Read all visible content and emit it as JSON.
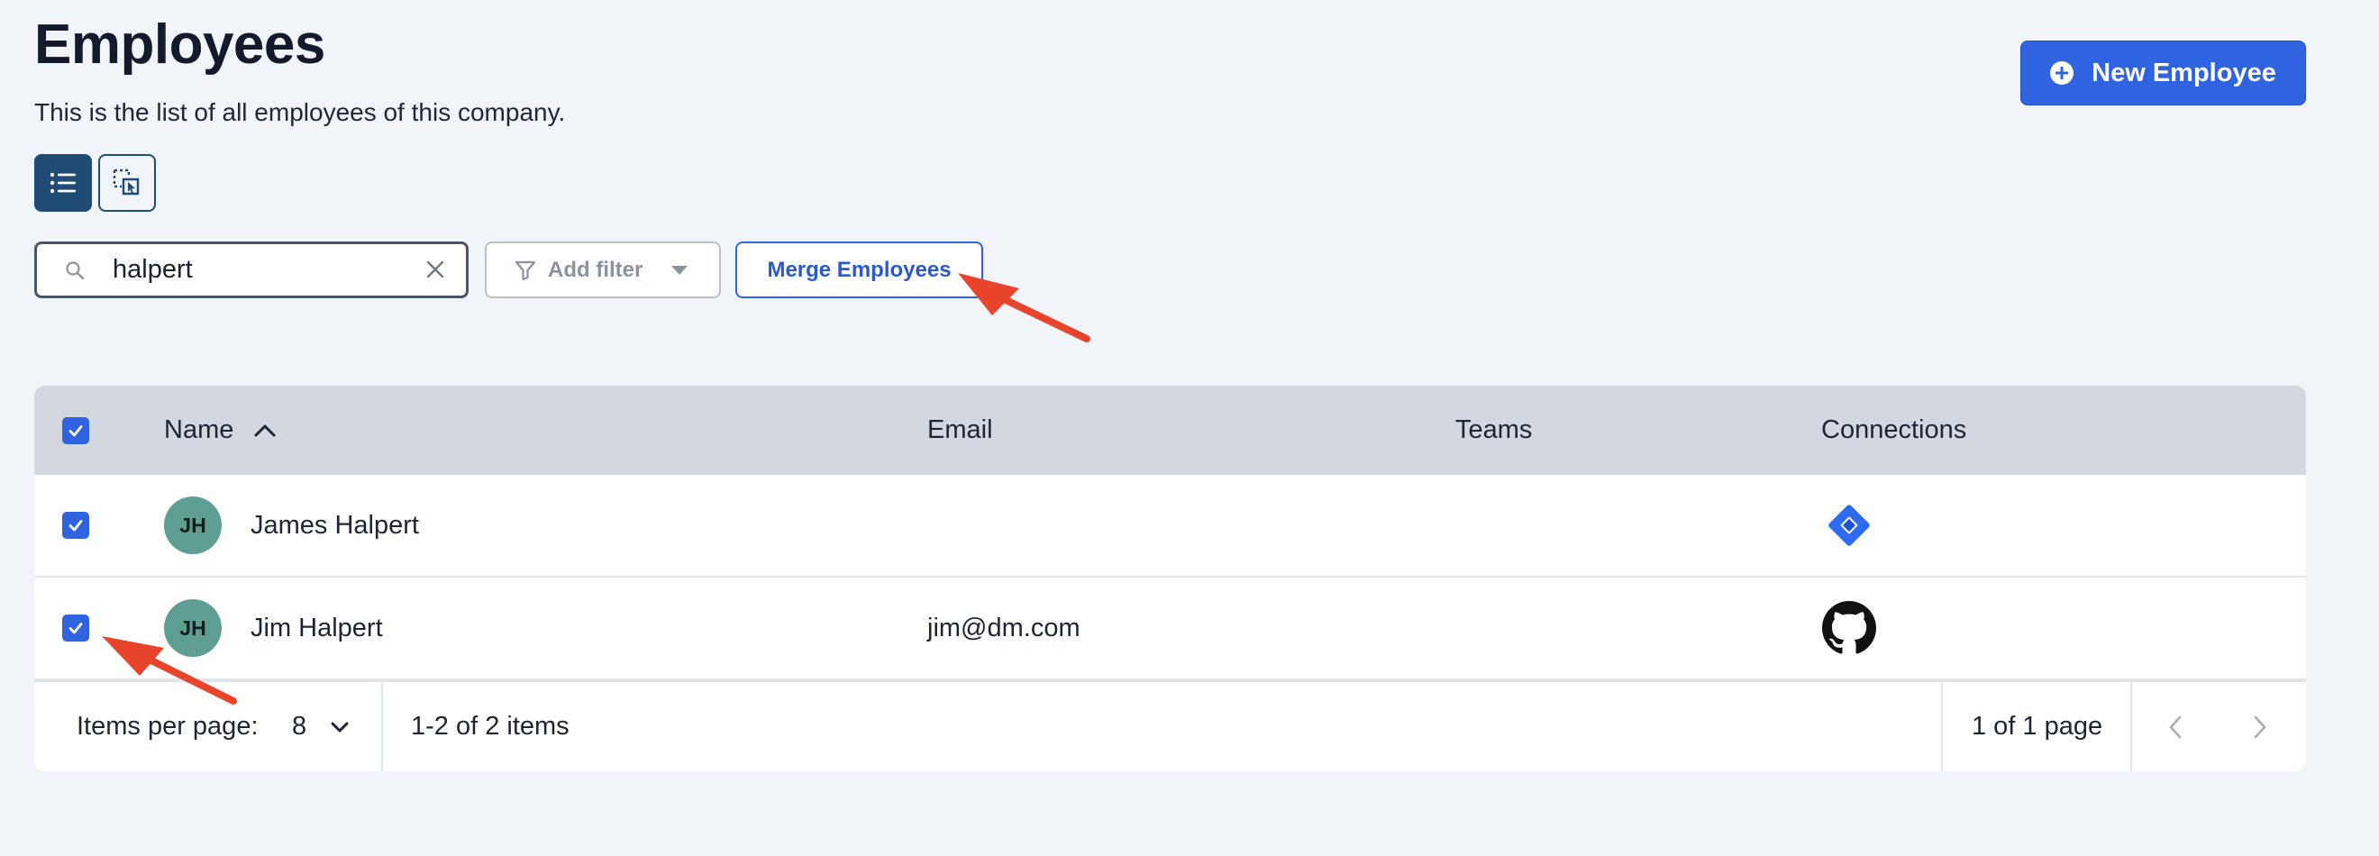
{
  "header": {
    "title": "Employees",
    "subtitle": "This is the list of all employees of this company.",
    "new_button_label": "New Employee"
  },
  "view_toggle": {
    "list_icon": "list-icon",
    "select_icon": "dashed-select-cursor-icon"
  },
  "filters": {
    "search_value": "halpert",
    "search_icon": "search-icon",
    "clear_icon": "close-icon",
    "add_filter_label": "Add filter",
    "merge_label": "Merge Employees"
  },
  "table": {
    "columns": [
      "Name",
      "Email",
      "Teams",
      "Connections"
    ],
    "sort": {
      "column": "Name",
      "direction": "ascending"
    },
    "all_selected": true,
    "rows": [
      {
        "selected": true,
        "initials": "JH",
        "name": "James Halpert",
        "email": "",
        "teams": "",
        "connection_icon": "jira-icon"
      },
      {
        "selected": true,
        "initials": "JH",
        "name": "Jim Halpert",
        "email": "jim@dm.com",
        "teams": "",
        "connection_icon": "github-icon"
      }
    ]
  },
  "pagination": {
    "items_per_page_label": "Items per page:",
    "items_per_page_value": "8",
    "range_text": "1-2 of 2 items",
    "page_text": "1 of 1 page"
  },
  "colors": {
    "primary": "#3063df",
    "dark_blue": "#1f4b74",
    "avatar": "#5f9e93",
    "annotation_arrow": "#e8432b"
  }
}
